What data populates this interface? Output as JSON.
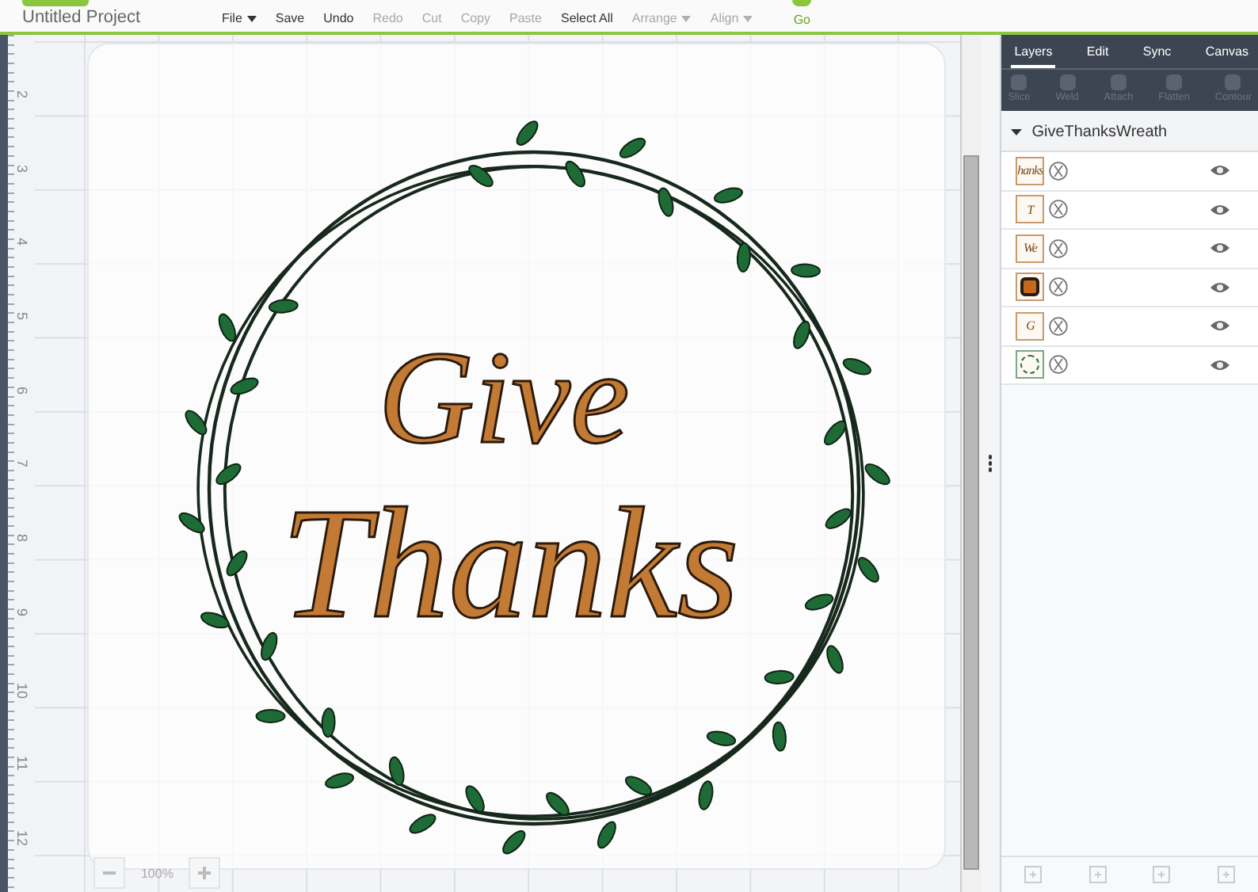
{
  "header": {
    "project_title": "Untitled Project",
    "toolbar": [
      {
        "label": "File",
        "disabled": false,
        "dropdown": true
      },
      {
        "label": "Save",
        "disabled": false,
        "dropdown": false
      },
      {
        "label": "Undo",
        "disabled": false,
        "dropdown": false
      },
      {
        "label": "Redo",
        "disabled": true,
        "dropdown": false
      },
      {
        "label": "Cut",
        "disabled": true,
        "dropdown": false
      },
      {
        "label": "Copy",
        "disabled": true,
        "dropdown": false
      },
      {
        "label": "Paste",
        "disabled": true,
        "dropdown": false
      },
      {
        "label": "Select All",
        "disabled": false,
        "dropdown": false
      },
      {
        "label": "Arrange",
        "disabled": true,
        "dropdown": true
      },
      {
        "label": "Align",
        "disabled": true,
        "dropdown": true
      }
    ],
    "go_label": "Go"
  },
  "ruler": [
    "2",
    "3",
    "4",
    "5",
    "6",
    "7",
    "8",
    "9",
    "10",
    "11",
    "12"
  ],
  "canvas": {
    "design_lines": [
      "Give",
      "Thanks"
    ],
    "zoom": "100%"
  },
  "panel": {
    "tabs": [
      {
        "label": "Layers",
        "selected": true
      },
      {
        "label": "Edit",
        "selected": false
      },
      {
        "label": "Sync",
        "selected": false
      },
      {
        "label": "Canvas",
        "selected": false
      }
    ],
    "tools": [
      {
        "label": "Slice",
        "disabled": true
      },
      {
        "label": "Weld",
        "disabled": true
      },
      {
        "label": "Attach",
        "disabled": true
      },
      {
        "label": "Flatten",
        "disabled": true
      },
      {
        "label": "Contour",
        "disabled": true
      }
    ],
    "group": {
      "name": "GiveThanksWreath",
      "expanded": true,
      "layers": [
        {
          "kind": "text",
          "glyph": "hanks",
          "visible": true
        },
        {
          "kind": "text",
          "glyph": "T",
          "visible": true
        },
        {
          "kind": "text",
          "glyph": "We",
          "visible": true
        },
        {
          "kind": "fill",
          "visible": true
        },
        {
          "kind": "text",
          "glyph": "G",
          "visible": true
        },
        {
          "kind": "wreath",
          "visible": true
        }
      ]
    }
  }
}
